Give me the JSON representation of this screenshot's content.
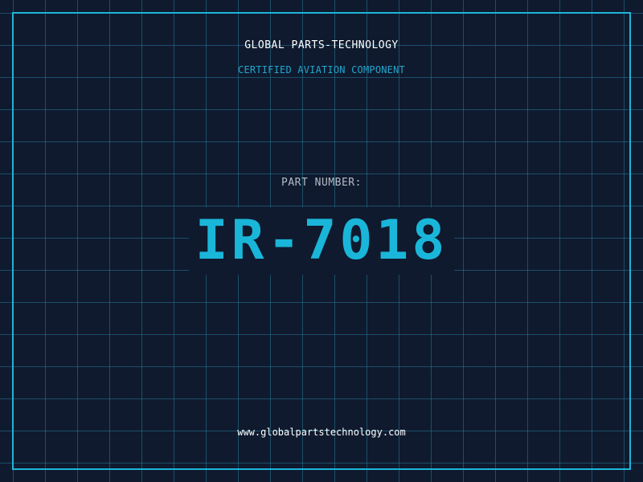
{
  "header": {
    "company": "GLOBAL PARTS-TECHNOLOGY",
    "tagline": "CERTIFIED AVIATION COMPONENT"
  },
  "part": {
    "label": "PART NUMBER:",
    "number": "IR-7018"
  },
  "footer": {
    "website": "www.globalpartstechnology.com"
  },
  "colors": {
    "background": "#0f1a2e",
    "accent": "#1ab6d9",
    "text": "#ffffff",
    "label": "#b3bcc6"
  }
}
